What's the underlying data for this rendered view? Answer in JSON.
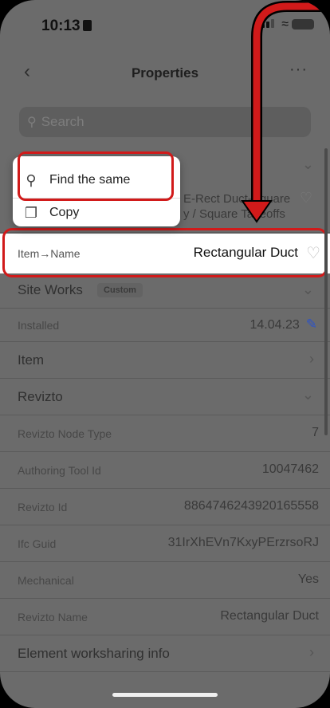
{
  "status_bar": {
    "time": "10:13"
  },
  "nav": {
    "title": "Properties",
    "back_icon": "chevron-left-icon",
    "more_icon": "ellipsis-icon"
  },
  "search": {
    "placeholder": "Search"
  },
  "context_menu": {
    "items": [
      {
        "label": "Find the same",
        "icon": "search-icon"
      },
      {
        "label": "Copy",
        "icon": "copy-icon"
      }
    ]
  },
  "partially_hidden_row": {
    "line1": "E-Rect Duct-Square",
    "line2": "y / Square Takeoffs"
  },
  "selected_row": {
    "label": "Item→Name",
    "value": "Rectangular Duct"
  },
  "rows": {
    "site_works": {
      "label": "Site Works",
      "badge": "Custom"
    },
    "installed": {
      "label": "Installed",
      "value": "14.04.23"
    },
    "item": {
      "label": "Item"
    },
    "revizto": {
      "label": "Revizto"
    },
    "node_type": {
      "label": "Revizto Node Type",
      "value": "7"
    },
    "authoring_tool_id": {
      "label": "Authoring Tool Id",
      "value": "10047462"
    },
    "revizto_id": {
      "label": "Revizto Id",
      "value": "8864746243920165558"
    },
    "ifc_guid": {
      "label": "Ifc Guid",
      "value": "31IrXhEVn7KxyPErzrsoRJ"
    },
    "mechanical": {
      "label": "Mechanical",
      "value": "Yes"
    },
    "revizto_name": {
      "label": "Revizto Name",
      "value": "Rectangular Duct"
    },
    "worksharing": {
      "label": "Element worksharing info"
    }
  },
  "colors": {
    "highlight": "#d11a1a",
    "accent_blue": "#2c53c9",
    "overlay": "#6b6b6b"
  }
}
